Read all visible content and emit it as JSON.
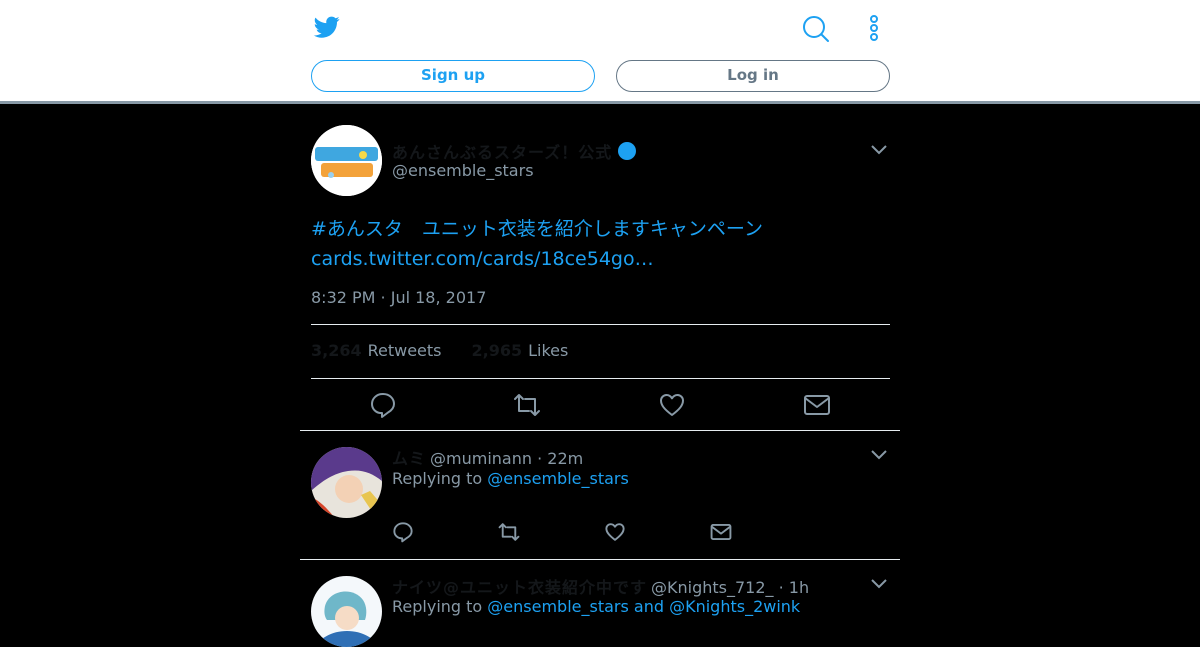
{
  "header": {
    "signup_label": "Sign up",
    "login_label": "Log in",
    "brand_color": "#1da1f2"
  },
  "tweet": {
    "display_name": "あんさんぶるスターズ！公式",
    "handle": "@ensemble_stars",
    "text_hashtag": "#あんスタ　ユニット衣装を紹介しますキャンペーン",
    "text_link": "cards.twitter.com/cards/18ce54go…",
    "timestamp": "8:32 PM · Jul 18, 2017",
    "retweets_count": "3,264",
    "retweets_label": "Retweets",
    "likes_count": "2,965",
    "likes_label": "Likes"
  },
  "replies": [
    {
      "name": "ムミ",
      "handle_time": "@muminann · 22m",
      "replying_prefix": "Replying to",
      "replying_to": "@ensemble_stars"
    },
    {
      "name": "ナイツ@ユニット衣装紹介中です",
      "handle_time": "@Knights_712_ · 1h",
      "replying_prefix": "Replying to",
      "replying_to": "@ensemble_stars and @Knights_2wink"
    }
  ]
}
